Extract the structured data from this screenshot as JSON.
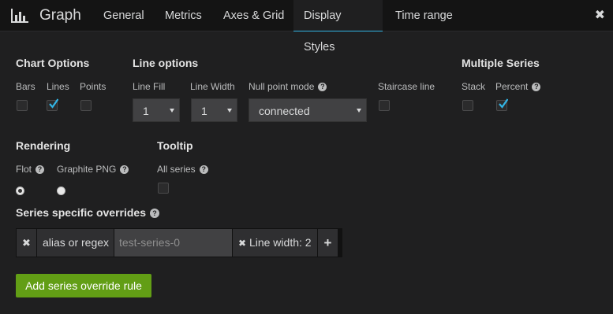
{
  "app": {
    "title": "Graph"
  },
  "tabs": [
    {
      "label": "General"
    },
    {
      "label": "Metrics"
    },
    {
      "label": "Axes & Grid"
    },
    {
      "label": "Display Styles"
    },
    {
      "label": "Time range"
    }
  ],
  "active_tab": "Display Styles",
  "chart_options": {
    "title": "Chart Options",
    "bars": {
      "label": "Bars",
      "checked": false
    },
    "lines": {
      "label": "Lines",
      "checked": true
    },
    "points": {
      "label": "Points",
      "checked": false
    }
  },
  "line_options": {
    "title": "Line options",
    "line_fill": {
      "label": "Line Fill",
      "value": "1"
    },
    "line_width": {
      "label": "Line Width",
      "value": "1"
    },
    "null_point_mode": {
      "label": "Null point mode",
      "value": "connected"
    },
    "staircase": {
      "label": "Staircase line",
      "checked": false
    }
  },
  "multiple_series": {
    "title": "Multiple Series",
    "stack": {
      "label": "Stack",
      "checked": false
    },
    "percent": {
      "label": "Percent",
      "checked": true
    }
  },
  "rendering": {
    "title": "Rendering",
    "flot": {
      "label": "Flot",
      "selected": true
    },
    "graphite_png": {
      "label": "Graphite PNG",
      "selected": false
    }
  },
  "tooltip": {
    "title": "Tooltip",
    "all_series": {
      "label": "All series",
      "checked": false
    }
  },
  "overrides": {
    "title": "Series specific overrides",
    "alias_label": "alias or regex",
    "alias_value": "test-series-0",
    "property_label": "Line width: 2",
    "add_button": "Add series override rule"
  },
  "colors": {
    "accent": "#33b5e5",
    "button_green": "#629e15",
    "background": "#1f1f20",
    "header": "#141414"
  },
  "icons": {
    "brand": "bar-chart-icon",
    "close": "close-icon",
    "help": "question-circle-icon",
    "remove": "times-icon",
    "add": "plus-icon"
  }
}
